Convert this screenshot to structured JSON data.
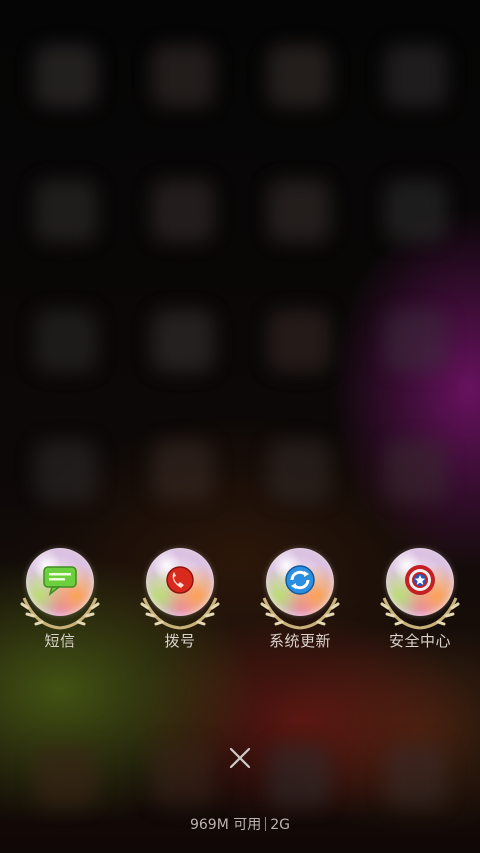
{
  "blurred_app_colors": [
    "#3a3434",
    "#3a302e",
    "#3d3330",
    "#33302f",
    "#333030",
    "#3a3030",
    "#3a3230",
    "#302f30",
    "#2e2c2c",
    "#3a3434",
    "#3a2c28",
    "#3c2c3c",
    "#302c2c",
    "#3a2c26",
    "#322a28",
    "#3a2a30",
    "#3a2418",
    "#3a241a",
    "#302c2c",
    "#3a2a28"
  ],
  "dock": {
    "apps": [
      {
        "label": "短信",
        "icon": "message-bubble-icon",
        "accent": "#6ccf3e"
      },
      {
        "label": "拨号",
        "icon": "phone-handset-icon",
        "accent": "#d92a1e"
      },
      {
        "label": "系统更新",
        "icon": "refresh-arrows-icon",
        "accent": "#2a8fe0"
      },
      {
        "label": "安全中心",
        "icon": "shield-star-icon",
        "accent": "#2b56b8"
      }
    ]
  },
  "close_button": {
    "icon": "close-icon"
  },
  "memory_status": {
    "available": "969M 可用",
    "network": "2G"
  }
}
